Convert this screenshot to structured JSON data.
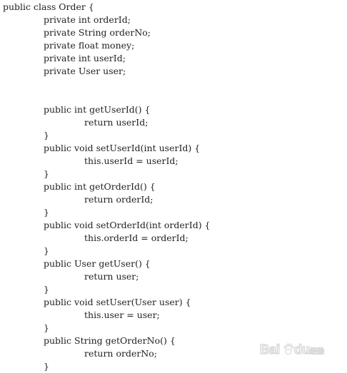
{
  "code": {
    "lines": [
      {
        "indent": 0,
        "text": "public class Order {"
      },
      {
        "indent": 1,
        "text": "private int orderId;"
      },
      {
        "indent": 1,
        "text": "private String orderNo;"
      },
      {
        "indent": 1,
        "text": "private float money;"
      },
      {
        "indent": 1,
        "text": "private int userId;"
      },
      {
        "indent": 1,
        "text": "private User user;"
      },
      {
        "indent": 0,
        "text": ""
      },
      {
        "indent": 0,
        "text": ""
      },
      {
        "indent": 1,
        "text": "public int getUserId() {"
      },
      {
        "indent": 2,
        "text": "return userId;"
      },
      {
        "indent": 1,
        "text": "}"
      },
      {
        "indent": 1,
        "text": "public void setUserId(int userId) {"
      },
      {
        "indent": 2,
        "text": "this.userId = userId;"
      },
      {
        "indent": 1,
        "text": "}"
      },
      {
        "indent": 1,
        "text": "public int getOrderId() {"
      },
      {
        "indent": 2,
        "text": "return orderId;"
      },
      {
        "indent": 1,
        "text": "}"
      },
      {
        "indent": 1,
        "text": "public void setOrderId(int orderId) {"
      },
      {
        "indent": 2,
        "text": "this.orderId = orderId;"
      },
      {
        "indent": 1,
        "text": "}"
      },
      {
        "indent": 1,
        "text": "public User getUser() {"
      },
      {
        "indent": 2,
        "text": "return user;"
      },
      {
        "indent": 1,
        "text": "}"
      },
      {
        "indent": 1,
        "text": "public void setUser(User user) {"
      },
      {
        "indent": 2,
        "text": "this.user = user;"
      },
      {
        "indent": 1,
        "text": "}"
      },
      {
        "indent": 1,
        "text": "public String getOrderNo() {"
      },
      {
        "indent": 2,
        "text": "return orderNo;"
      },
      {
        "indent": 1,
        "text": "}"
      }
    ]
  },
  "watermark": {
    "brand": "Bai du",
    "label": "经验"
  }
}
